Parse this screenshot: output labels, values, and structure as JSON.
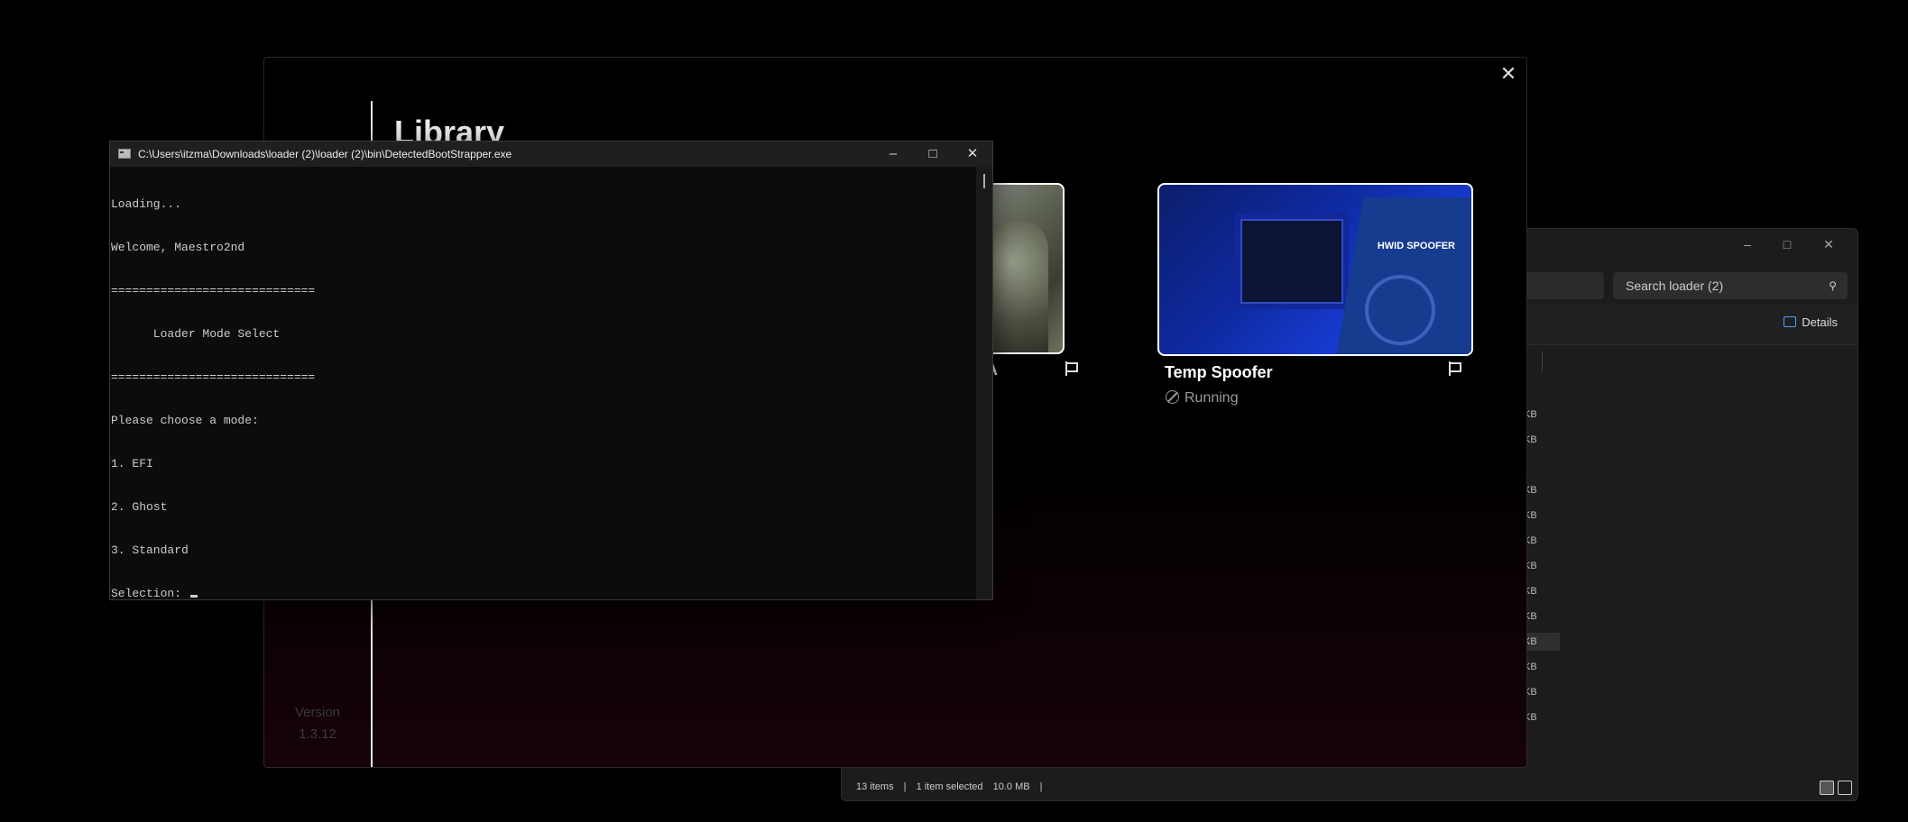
{
  "explorer": {
    "search_placeholder": "Search loader (2)",
    "details_label": "Details",
    "size_fragments": [
      "KB",
      "KB",
      "KB",
      "KB",
      "KB",
      "KB",
      "KB",
      "KB",
      "KB",
      "KB",
      "KB",
      "KB"
    ],
    "status": {
      "items": "13 items",
      "separator": "|",
      "selected": "1 item selected",
      "size": "10.0 MB"
    }
  },
  "library": {
    "title": "Library",
    "version_label": "Version",
    "version_number": "1.3.12",
    "card1_partial_label": "A",
    "card2": {
      "name": "Temp Spoofer",
      "status": "Running",
      "image_text": "HWID SPOOFER"
    }
  },
  "console": {
    "title": "C:\\Users\\itzma\\Downloads\\loader (2)\\loader (2)\\bin\\DetectedBootStrapper.exe",
    "lines": [
      "Loading...",
      "Welcome, Maestro2nd",
      "=============================",
      "      Loader Mode Select",
      "=============================",
      "Please choose a mode:",
      "1. EFI",
      "2. Ghost",
      "3. Standard",
      "Selection: "
    ]
  }
}
